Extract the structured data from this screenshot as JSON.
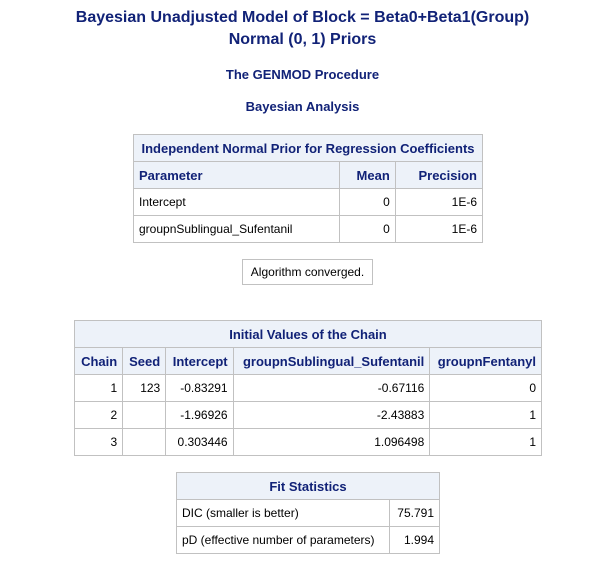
{
  "titles": {
    "title1": "Bayesian Unadjusted Model of Block = Beta0+Beta1(Group)",
    "title2": "Normal (0, 1) Priors",
    "procedure": "The GENMOD Procedure",
    "analysis": "Bayesian Analysis"
  },
  "prior_table": {
    "caption": "Independent Normal Prior for Regression Coefficients",
    "headers": [
      "Parameter",
      "Mean",
      "Precision"
    ],
    "rows": [
      [
        "Intercept",
        "0",
        "1E-6"
      ],
      [
        "groupnSublingual_Sufentanil",
        "0",
        "1E-6"
      ]
    ]
  },
  "convergence_note": "Algorithm converged.",
  "initial_values_table": {
    "caption": "Initial Values of the Chain",
    "headers": [
      "Chain",
      "Seed",
      "Intercept",
      "groupnSublingual_Sufentanil",
      "groupnFentanyl"
    ],
    "rows": [
      [
        "1",
        "123",
        "-0.83291",
        "-0.67116",
        "0"
      ],
      [
        "2",
        "",
        "-1.96926",
        "-2.43883",
        "1"
      ],
      [
        "3",
        "",
        "0.303446",
        "1.096498",
        "1"
      ]
    ]
  },
  "fit_table": {
    "caption": "Fit Statistics",
    "rows": [
      [
        "DIC (smaller is better)",
        "75.791"
      ],
      [
        "pD (effective number of parameters)",
        "1.994"
      ]
    ]
  }
}
